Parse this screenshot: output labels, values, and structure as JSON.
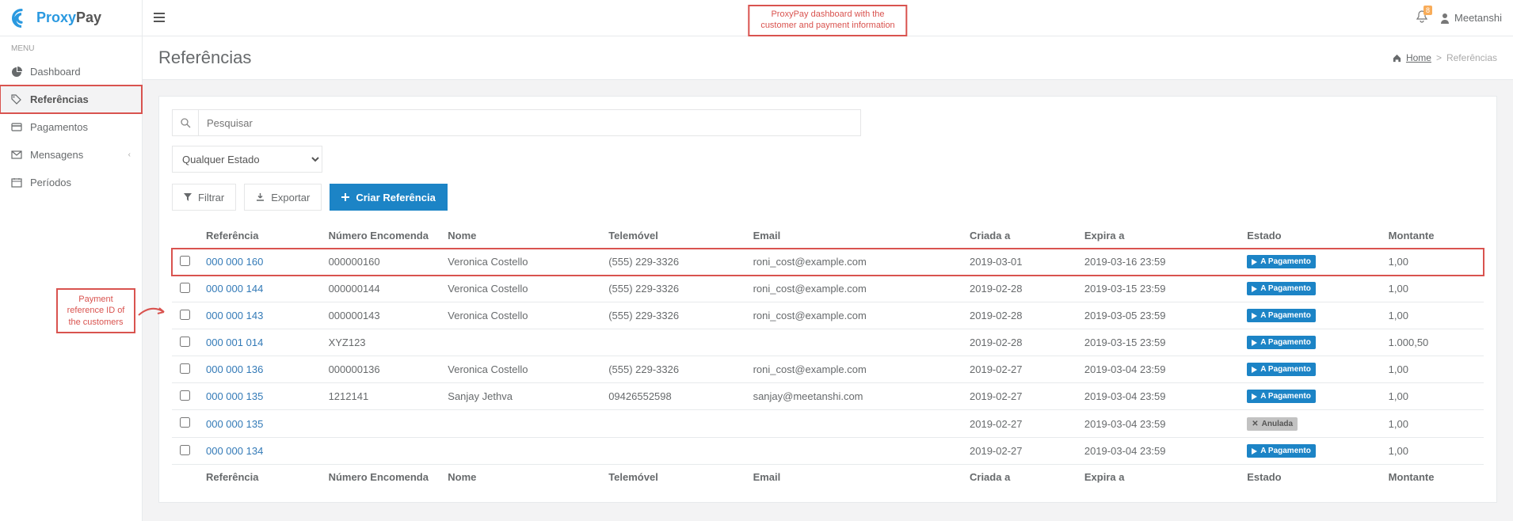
{
  "brand": {
    "p1": "Proxy",
    "p2": "Pay"
  },
  "annot_top": "ProxyPay dashboard with the\ncustomer and payment information",
  "annot_side": "Payment reference ID of the customers",
  "menu_heading": "MENU",
  "sidebar": {
    "items": [
      {
        "label": "Dashboard",
        "icon": "dashboard-icon"
      },
      {
        "label": "Referências",
        "icon": "tags-icon",
        "active": true,
        "highlighted": true
      },
      {
        "label": "Pagamentos",
        "icon": "card-icon"
      },
      {
        "label": "Mensagens",
        "icon": "envelope-icon",
        "chevron": true
      },
      {
        "label": "Períodos",
        "icon": "calendar-icon"
      }
    ]
  },
  "topbar": {
    "bell_badge": "8",
    "user": "Meetanshi"
  },
  "page": {
    "title": "Referências",
    "breadcrumb_home": "Home",
    "breadcrumb_current": "Referências"
  },
  "search": {
    "placeholder": "Pesquisar"
  },
  "state_filter": "Qualquer Estado",
  "buttons": {
    "filter": "Filtrar",
    "export": "Exportar",
    "create": "Criar Referência"
  },
  "columns": {
    "ref": "Referência",
    "order": "Número Encomenda",
    "name": "Nome",
    "phone": "Telemóvel",
    "email": "Email",
    "created": "Criada a",
    "expires": "Expira a",
    "status": "Estado",
    "amount": "Montante"
  },
  "status_labels": {
    "pending": "A Pagamento",
    "cancelled": "Anulada"
  },
  "rows": [
    {
      "ref": "000 000 160",
      "order": "000000160",
      "name": "Veronica Costello",
      "phone": "(555) 229-3326",
      "email": "roni_cost@example.com",
      "created": "2019-03-01",
      "expires": "2019-03-16 23:59",
      "status": "pending",
      "amount": "1,00",
      "highlight": true
    },
    {
      "ref": "000 000 144",
      "order": "000000144",
      "name": "Veronica Costello",
      "phone": "(555) 229-3326",
      "email": "roni_cost@example.com",
      "created": "2019-02-28",
      "expires": "2019-03-15 23:59",
      "status": "pending",
      "amount": "1,00"
    },
    {
      "ref": "000 000 143",
      "order": "000000143",
      "name": "Veronica Costello",
      "phone": "(555) 229-3326",
      "email": "roni_cost@example.com",
      "created": "2019-02-28",
      "expires": "2019-03-05 23:59",
      "status": "pending",
      "amount": "1,00"
    },
    {
      "ref": "000 001 014",
      "order": "XYZ123",
      "name": "",
      "phone": "",
      "email": "",
      "created": "2019-02-28",
      "expires": "2019-03-15 23:59",
      "status": "pending",
      "amount": "1.000,50"
    },
    {
      "ref": "000 000 136",
      "order": "000000136",
      "name": "Veronica Costello",
      "phone": "(555) 229-3326",
      "email": "roni_cost@example.com",
      "created": "2019-02-27",
      "expires": "2019-03-04 23:59",
      "status": "pending",
      "amount": "1,00"
    },
    {
      "ref": "000 000 135",
      "order": "1212141",
      "name": "Sanjay Jethva",
      "phone": "09426552598",
      "email": "sanjay@meetanshi.com",
      "created": "2019-02-27",
      "expires": "2019-03-04 23:59",
      "status": "pending",
      "amount": "1,00"
    },
    {
      "ref": "000 000 135",
      "order": "",
      "name": "",
      "phone": "",
      "email": "",
      "created": "2019-02-27",
      "expires": "2019-03-04 23:59",
      "status": "cancelled",
      "amount": "1,00"
    },
    {
      "ref": "000 000 134",
      "order": "",
      "name": "",
      "phone": "",
      "email": "",
      "created": "2019-02-27",
      "expires": "2019-03-04 23:59",
      "status": "pending",
      "amount": "1,00"
    }
  ]
}
